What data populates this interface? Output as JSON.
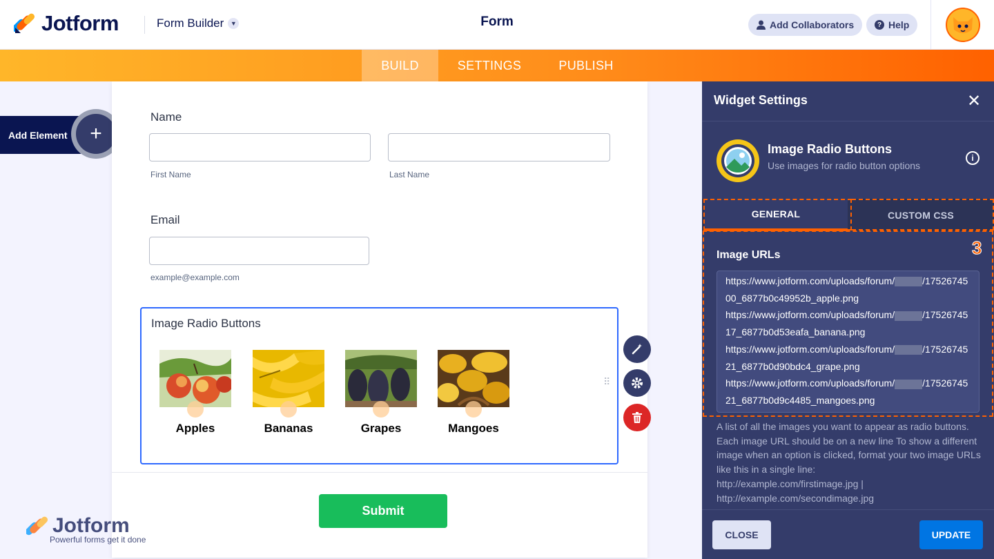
{
  "header": {
    "brand": "Jotform",
    "builder_menu": "Form Builder",
    "form_title": "Form",
    "add_collaborators": "Add Collaborators",
    "help": "Help"
  },
  "nav_tabs": [
    "BUILD",
    "SETTINGS",
    "PUBLISH"
  ],
  "add_element": "Add Element",
  "form": {
    "name_label": "Name",
    "first_name_sub": "First Name",
    "last_name_sub": "Last Name",
    "email_label": "Email",
    "email_sub": "example@example.com",
    "image_radio_label": "Image Radio Buttons",
    "options": [
      "Apples",
      "Bananas",
      "Grapes",
      "Mangoes"
    ],
    "submit": "Submit"
  },
  "watermark": {
    "brand": "Jotform",
    "tagline": "Powerful forms get it done"
  },
  "panel": {
    "title": "Widget Settings",
    "widget_name": "Image Radio Buttons",
    "widget_desc": "Use images for radio button options",
    "tab_general": "GENERAL",
    "tab_css": "CUSTOM CSS",
    "annotation": "3",
    "field_label": "Image URLs",
    "url_prefix": "https://www.jotform.com/uploads/forum/",
    "url_mid": "/175",
    "url_files": [
      "2674500_6877b0c49952b_apple.png",
      "2674517_6877b0d53eafa_banana.png",
      "2674521_6877b0d90bdc4_grape.png",
      "2674521_6877b0d9c4485_mangoes.png"
    ],
    "help_text": "A list of all the images you want to appear as radio buttons. Each image URL should be on a new line To show a different image when an option is clicked, format your two image URLs like this in a single line:",
    "help_ex1": "http://example.com/firstimage.jpg |",
    "help_ex2": "http://example.com/secondimage.jpg",
    "close": "CLOSE",
    "update": "UPDATE"
  },
  "colors": {
    "navy": "#0a1551",
    "orange": "#ff6100",
    "panel": "#343c6a",
    "submit_green": "#18bd5b",
    "update_blue": "#0075e3",
    "selected_border": "#2e69ff",
    "delete_red": "#dc2626"
  }
}
